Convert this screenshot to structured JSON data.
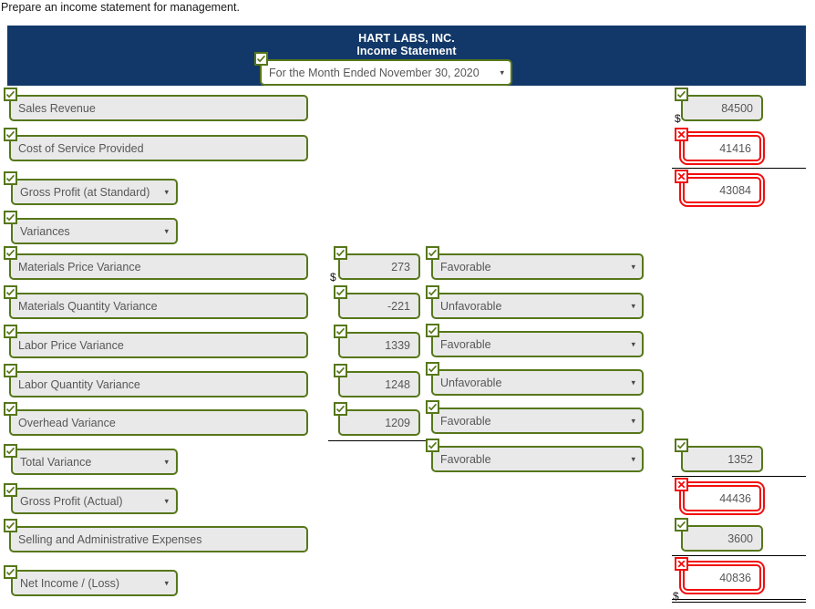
{
  "instruction": "Prepare an income statement for management.",
  "statement": {
    "company": "HART LABS, INC.",
    "title": "Income Statement",
    "period_value": "For the Month Ended November 30, 2020",
    "period_status": "correct"
  },
  "colors": {
    "header_band": "#123869",
    "correct_border": "#56771a",
    "incorrect_border": "#f20d0d",
    "field_fill": "#e9e9e9",
    "field_text": "#575757",
    "header_text": "#ffffff"
  },
  "symbols": {
    "dollar": "$",
    "caret": "▾"
  },
  "rows": [
    {
      "label": "Sales Revenue",
      "label_kind": "text",
      "label_status": "correct",
      "amount": "84500",
      "amount_status": "correct",
      "amount_dollar": true
    },
    {
      "label": "Cost of Service Provided",
      "label_kind": "text",
      "label_status": "correct",
      "amount": "41416",
      "amount_status": "incorrect",
      "amount_dollar": false
    },
    {
      "label": "Gross Profit (at Standard)",
      "label_kind": "select",
      "label_status": "correct",
      "amount": "43084",
      "amount_status": "incorrect",
      "amount_dollar": false
    },
    {
      "label": "Variances",
      "label_kind": "select",
      "label_status": "correct"
    },
    {
      "label": "Materials Price Variance",
      "label_kind": "text",
      "label_status": "correct",
      "variance_amount": "273",
      "variance_amount_status": "correct",
      "variance_amount_dollar": true,
      "variance_type": "Favorable",
      "variance_type_status": "correct"
    },
    {
      "label": "Materials Quantity Variance",
      "label_kind": "text",
      "label_status": "correct",
      "variance_amount": "-221",
      "variance_amount_status": "correct",
      "variance_amount_dollar": false,
      "variance_type": "Unfavorable",
      "variance_type_status": "correct"
    },
    {
      "label": "Labor Price Variance",
      "label_kind": "text",
      "label_status": "correct",
      "variance_amount": "1339",
      "variance_amount_status": "correct",
      "variance_amount_dollar": false,
      "variance_type": "Favorable",
      "variance_type_status": "correct"
    },
    {
      "label": "Labor Quantity Variance",
      "label_kind": "text",
      "label_status": "correct",
      "variance_amount": "1248",
      "variance_amount_status": "correct",
      "variance_amount_dollar": false,
      "variance_type": "Unfavorable",
      "variance_type_status": "correct"
    },
    {
      "label": "Overhead Variance",
      "label_kind": "text",
      "label_status": "correct",
      "variance_amount": "1209",
      "variance_amount_status": "correct",
      "variance_amount_dollar": false,
      "variance_type": "Favorable",
      "variance_type_status": "correct"
    },
    {
      "label": "Total Variance",
      "label_kind": "select",
      "label_status": "correct",
      "variance_type": "Favorable",
      "variance_type_status": "correct",
      "amount": "1352",
      "amount_status": "correct",
      "amount_dollar": false
    },
    {
      "label": "Gross Profit (Actual)",
      "label_kind": "select",
      "label_status": "correct",
      "amount": "44436",
      "amount_status": "incorrect",
      "amount_dollar": false
    },
    {
      "label": "Selling and Administrative Expenses",
      "label_kind": "text",
      "label_status": "correct",
      "amount": "3600",
      "amount_status": "correct",
      "amount_dollar": false
    },
    {
      "label": "Net Income / (Loss)",
      "label_kind": "select",
      "label_status": "correct",
      "amount": "40836",
      "amount_status": "incorrect",
      "amount_dollar": true
    }
  ]
}
